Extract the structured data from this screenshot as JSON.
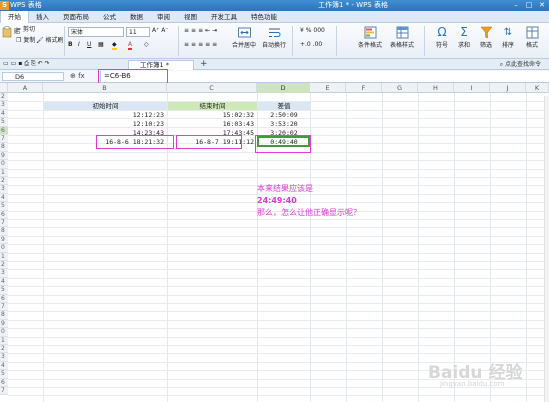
{
  "titlebar": {
    "app_logo": "S",
    "app_name": "WPS 表格",
    "doc_title": "工作簿1 * - WPS 表格",
    "win_min": "–",
    "win_max": "□",
    "win_close": "✕"
  },
  "menu": [
    "开始",
    "插入",
    "页面布局",
    "公式",
    "数据",
    "审阅",
    "视图",
    "开发工具",
    "特色功能"
  ],
  "ribbon": {
    "paste": "贴",
    "cut": "剪切",
    "copy": "复制",
    "format_painter": "格式刷",
    "font_name": "宋体",
    "font_size": "11",
    "merge_center": "合并居中",
    "wrap_text": "自动换行",
    "conditional_format": "条件格式",
    "table_style": "表格样式",
    "symbol": "符号",
    "sum": "求和",
    "filter": "筛选",
    "sort": "排序",
    "format": "格式"
  },
  "tabstrip": {
    "doc_tab": "工作簿1 *",
    "add": "+",
    "tip": "点此查找命令"
  },
  "formula_bar": {
    "name_box": "D6",
    "icons": "⊕ fx",
    "formula": "=C6-B6"
  },
  "columns": [
    "A",
    "B",
    "C",
    "D",
    "E",
    "F",
    "G",
    "H",
    "I",
    "J",
    "K"
  ],
  "rows": [
    "2",
    "3",
    "4",
    "5",
    "6",
    "7",
    "8",
    "9",
    "0",
    "1",
    "2",
    "3",
    "4",
    "5",
    "6",
    "7",
    "8",
    "9",
    "0",
    "1",
    "2",
    "3",
    "4",
    "5",
    "6",
    "7",
    "8",
    "9",
    "0",
    "1",
    "2",
    "3",
    "4",
    "5",
    "6",
    "7"
  ],
  "sheet": {
    "headers": {
      "b": "初始时间",
      "c": "结束时间",
      "d": "差值"
    },
    "rows": [
      {
        "b": "12:12:23",
        "c": "15:02:32",
        "d": "2:50:09"
      },
      {
        "b": "12:10:23",
        "c": "16:03:43",
        "d": "3:53:20"
      },
      {
        "b": "14:23:43",
        "c": "17:43:45",
        "d": "3:20:02"
      },
      {
        "b": "16-8-6 18:21:32",
        "c": "16-8-7 19:11:12",
        "d": "0:49:40"
      }
    ]
  },
  "note": {
    "line1": "本来结果应该是",
    "line2": "24:49:40",
    "line3": "那么，怎么让他正确显示呢？"
  },
  "watermark": {
    "main": "Baidu 经验",
    "sub": "jingyan.baidu.com"
  },
  "colors": {
    "accent_pink": "#e037d8",
    "selection_green": "#3e9c3a",
    "header_blue": "#dbe6f4",
    "header_green": "#cfe8b8"
  }
}
